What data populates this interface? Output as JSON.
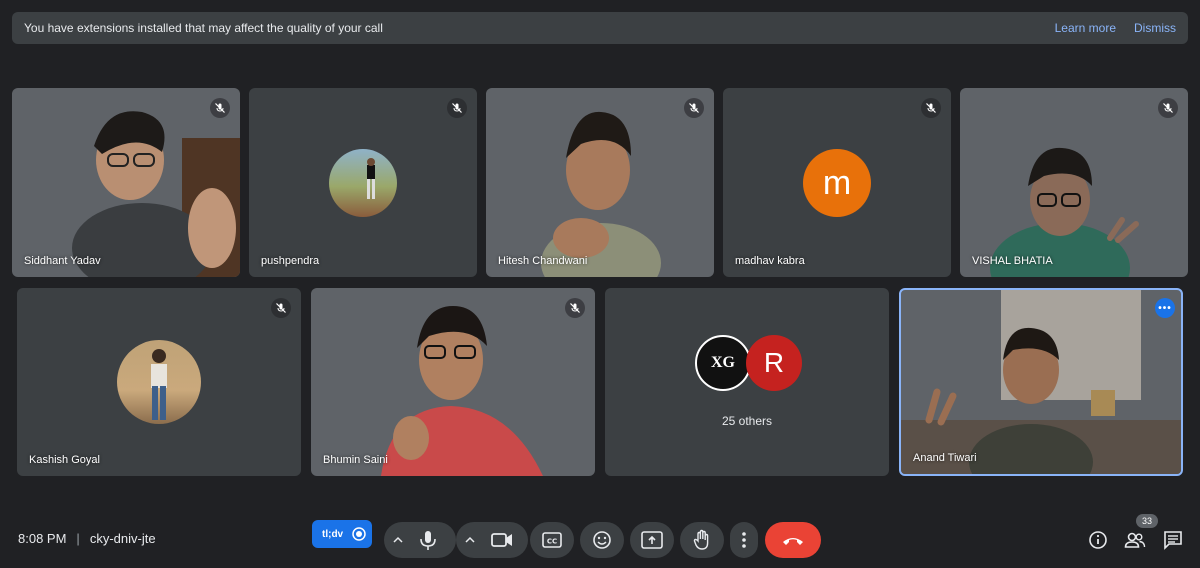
{
  "banner": {
    "message": "You have extensions installed that may affect the quality of your call",
    "learn_more": "Learn more",
    "dismiss": "Dismiss"
  },
  "participants": [
    {
      "name": "Siddhant Yadav",
      "muted": true
    },
    {
      "name": "pushpendra",
      "muted": true
    },
    {
      "name": "Hitesh Chandwani",
      "muted": true
    },
    {
      "name": "madhav kabra",
      "muted": true,
      "avatar_letter": "m",
      "avatar_color": "#e8710a"
    },
    {
      "name": "VISHAL BHATIA",
      "muted": true
    },
    {
      "name": "Kashish Goyal",
      "muted": true
    },
    {
      "name": "Bhumin Saini",
      "muted": true
    },
    {
      "name": "Anand Tiwari",
      "muted": false,
      "active_speaker": true
    }
  ],
  "others_tile": {
    "label": "25 others",
    "avatar_r_letter": "R",
    "avatar_r_color": "#c5221f",
    "avatar_logo_text": "XG"
  },
  "bottombar": {
    "time": "8:08 PM",
    "separator": "|",
    "meeting_code": "cky-dniv-jte",
    "extension_label": "tl;dv",
    "participant_count": "33"
  },
  "colors": {
    "background": "#202124",
    "tile": "#3c4043",
    "accent": "#8ab4f8",
    "end_call": "#ea4335"
  }
}
